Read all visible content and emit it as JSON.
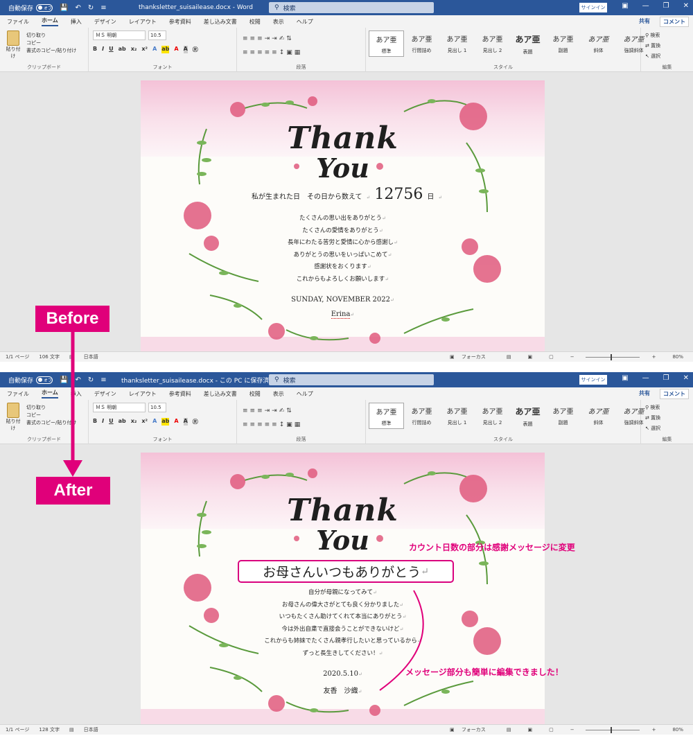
{
  "before": {
    "titlebar": {
      "autosave_label": "自動保存",
      "autosave_state": "オフ",
      "doc_title": "thanksletter_suisailease.docx  -  Word",
      "search_placeholder": "検索",
      "signin": "サインイン"
    },
    "status": {
      "page": "1/1 ページ",
      "words": "106 文字",
      "lang": "日本語",
      "focus": "フォーカス",
      "zoom": "80%"
    },
    "letter": {
      "title_line1": "Thank",
      "title_line2": "You",
      "count_prefix": "私が生まれた日　その日から数えて",
      "count_number": "12756",
      "count_suffix": "日",
      "lines": [
        "たくさんの思い出をありがとう",
        "たくさんの愛情をありがとう",
        "長年にわたる苦労と愛情に心から感謝し",
        "ありがとうの思いをいっぱいこめて",
        "感謝状をおくります",
        "これからもよろしくお願いします"
      ],
      "date": "SUNDAY, NOVEMBER 2022",
      "signature": "Erina"
    }
  },
  "after": {
    "titlebar": {
      "autosave_label": "自動保存",
      "autosave_state": "オフ",
      "doc_title": "thanksletter_suisailease.docx  -  この PC に保存済み  ▾",
      "search_placeholder": "検索",
      "signin": "サインイン"
    },
    "status": {
      "page": "1/1 ページ",
      "words": "128 文字",
      "lang": "日本語",
      "focus": "フォーカス",
      "zoom": "80%"
    },
    "letter": {
      "title_line1": "Thank",
      "title_line2": "You",
      "headline": "お母さんいつもありがとう",
      "lines": [
        "自分が母親になってみて",
        "お母さんの偉大さがとても良く分かりました",
        "いつもたくさん助けてくれて本当にありがとう",
        "今は外出自粛で直接会うことができないけど",
        "これからも姉妹でたくさん親孝行したいと思っているから",
        "ずっと長生きしてください！"
      ],
      "date": "2020.5.10",
      "signature": "友香　沙織"
    }
  },
  "menu": {
    "tabs": [
      "ファイル",
      "ホーム",
      "挿入",
      "デザイン",
      "レイアウト",
      "参考資料",
      "差し込み文書",
      "校閲",
      "表示",
      "ヘルプ"
    ],
    "share": "共有",
    "comment": "コメント"
  },
  "ribbon": {
    "paste": "貼り付け",
    "cut": "切り取り",
    "copy": "コピー",
    "format_painter": "書式のコピー/貼り付け",
    "clipboard": "クリップボード",
    "font_name": "ＭＳ 明朝",
    "font_size": "10.5",
    "font_group": "フォント",
    "paragraph_group": "段落",
    "styles_group": "スタイル",
    "styles": [
      {
        "sample": "あア亜",
        "name": "標準"
      },
      {
        "sample": "あア亜",
        "name": "行間詰め"
      },
      {
        "sample": "あア亜",
        "name": "見出し 1"
      },
      {
        "sample": "あア亜",
        "name": "見出し 2"
      },
      {
        "sample": "あア亜",
        "name": "表題"
      },
      {
        "sample": "あア亜",
        "name": "副題"
      },
      {
        "sample": "あア亜",
        "name": "斜体"
      },
      {
        "sample": "あア亜",
        "name": "強調斜体"
      }
    ],
    "find": "検索",
    "replace": "置換",
    "select": "選択",
    "edit_group": "編集"
  },
  "annotations": {
    "before_label": "Before",
    "after_label": "After",
    "callout_1": "カウント日数の部分は感謝メッセージに変更",
    "callout_2": "メッセージ部分も簡単に編集できました！",
    "accent_color": "#e0007a"
  }
}
